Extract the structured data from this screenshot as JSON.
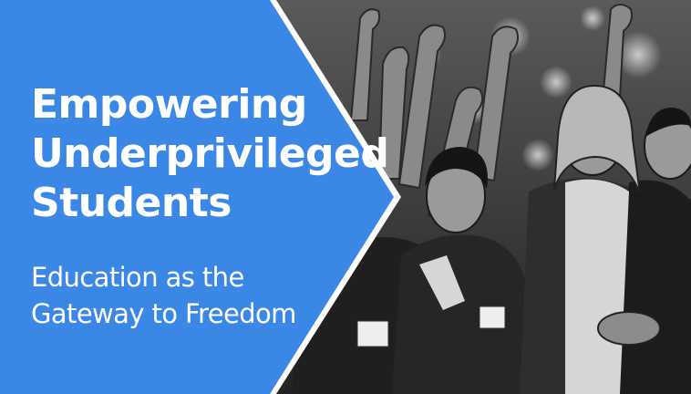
{
  "banner": {
    "headline_lines": [
      "Empowering",
      "Underprivileged",
      "Students"
    ],
    "subhead_lines": [
      "Education as the",
      "Gateway to Freedom"
    ],
    "panel_color": "#3a87e6",
    "divider_color": "#ffffff",
    "photo_description_icon": "group-photo-bw"
  }
}
